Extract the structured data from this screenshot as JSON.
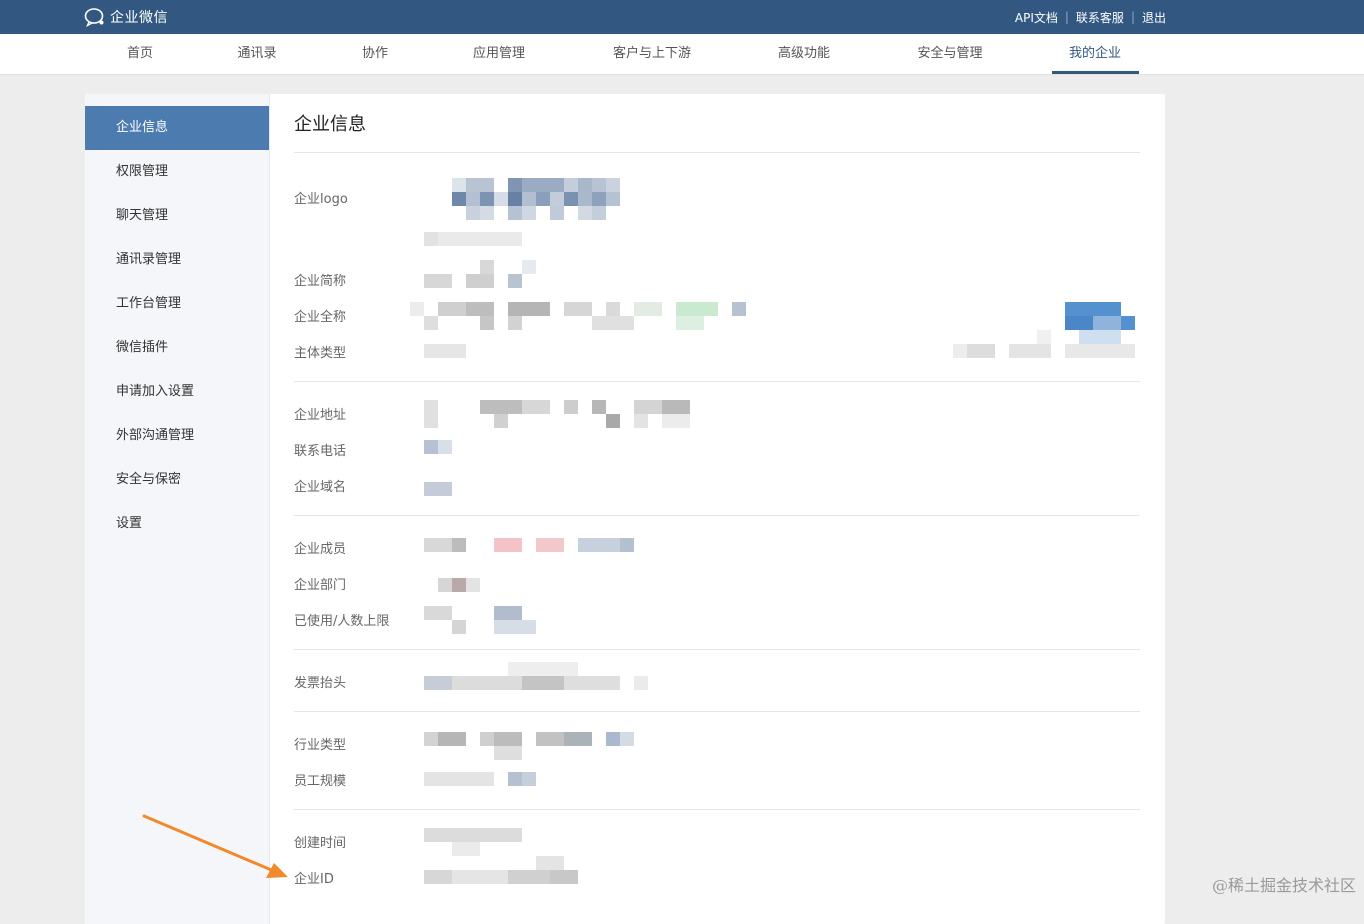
{
  "brand": {
    "name": "企业微信",
    "icon": "wecom-chat-bubble-icon"
  },
  "toplinks": [
    {
      "label": "API文档"
    },
    {
      "label": "联系客服"
    },
    {
      "label": "退出"
    }
  ],
  "toplink_sep": "|",
  "nav": {
    "items": [
      {
        "label": "首页"
      },
      {
        "label": "通讯录"
      },
      {
        "label": "协作"
      },
      {
        "label": "应用管理"
      },
      {
        "label": "客户与上下游"
      },
      {
        "label": "高级功能"
      },
      {
        "label": "安全与管理"
      },
      {
        "label": "我的企业"
      }
    ],
    "active_index": 7
  },
  "sidebar": {
    "items": [
      {
        "label": "企业信息"
      },
      {
        "label": "权限管理"
      },
      {
        "label": "聊天管理"
      },
      {
        "label": "通讯录管理"
      },
      {
        "label": "工作台管理"
      },
      {
        "label": "微信插件"
      },
      {
        "label": "申请加入设置"
      },
      {
        "label": "外部沟通管理"
      },
      {
        "label": "安全与保密"
      },
      {
        "label": "设置"
      }
    ],
    "active_index": 0
  },
  "main": {
    "title": "企业信息",
    "fields": {
      "logo": "企业logo",
      "short_name": "企业简称",
      "full_name": "企业全称",
      "entity_type": "主体类型",
      "address": "企业地址",
      "phone": "联系电话",
      "domain": "企业域名",
      "members": "企业成员",
      "departments": "企业部门",
      "usage": "已使用/人数上限",
      "invoice": "发票抬头",
      "industry": "行业类型",
      "staff_size": "员工规模",
      "created": "创建时间",
      "corp_id": "企业ID"
    }
  },
  "colors": {
    "topbar": "#325881",
    "accent": "#4c7bb0",
    "arrow": "#f08a2c"
  },
  "watermark": "@稀土掘金技术社区"
}
